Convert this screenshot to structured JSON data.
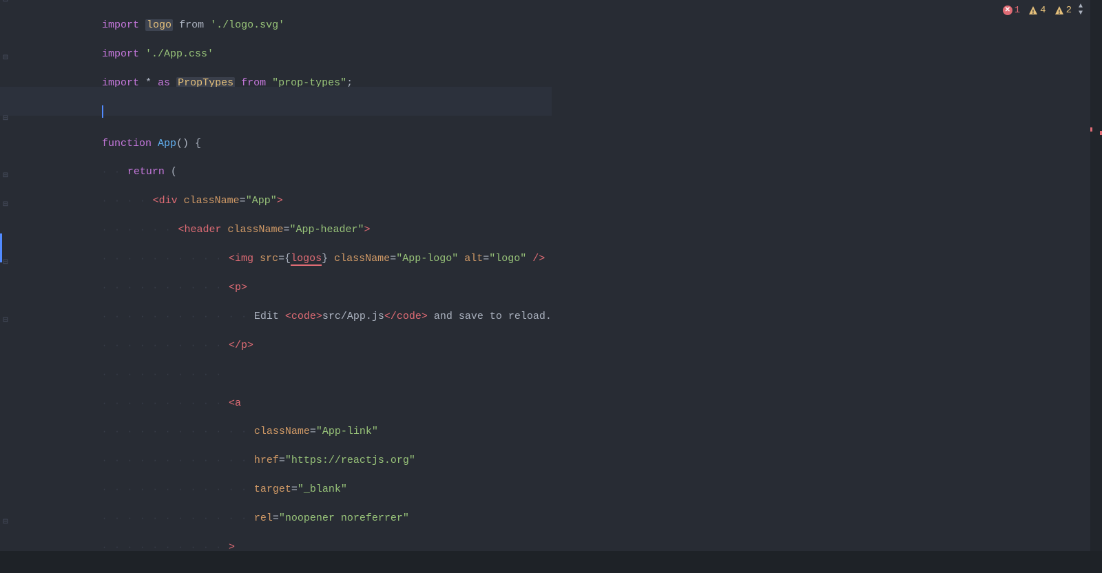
{
  "editor": {
    "background": "#282c34",
    "lines": [
      {
        "id": 1,
        "fold": true,
        "indent": 0,
        "tokens": [
          {
            "type": "kw",
            "text": "import "
          },
          {
            "type": "ident",
            "text": "logo"
          },
          {
            "type": "plain",
            "text": " "
          },
          {
            "type": "plain",
            "text": "from"
          },
          {
            "type": "plain",
            "text": " "
          },
          {
            "type": "str",
            "text": "'./logo.svg'"
          }
        ]
      },
      {
        "id": 2,
        "fold": false,
        "indent": 0,
        "tokens": [
          {
            "type": "kw",
            "text": "import "
          },
          {
            "type": "str",
            "text": "'./App.css'"
          }
        ]
      },
      {
        "id": 3,
        "fold": true,
        "indent": 0,
        "tokens": [
          {
            "type": "kw",
            "text": "import "
          },
          {
            "type": "plain",
            "text": "* "
          },
          {
            "type": "kw",
            "text": "as "
          },
          {
            "type": "ident-highlight",
            "text": "PropTypes"
          },
          {
            "type": "plain",
            "text": " "
          },
          {
            "type": "kw",
            "text": "from"
          },
          {
            "type": "plain",
            "text": " "
          },
          {
            "type": "str-squiggle",
            "text": "\"prop-types\""
          },
          {
            "type": "plain",
            "text": ";"
          }
        ]
      },
      {
        "id": 4,
        "fold": false,
        "indent": 0,
        "active": true,
        "tokens": []
      },
      {
        "id": 5,
        "fold": true,
        "indent": 0,
        "tokens": [
          {
            "type": "kw",
            "text": "function "
          },
          {
            "type": "fn",
            "text": "App"
          },
          {
            "type": "plain",
            "text": "() {"
          }
        ]
      },
      {
        "id": 6,
        "fold": false,
        "indent": 1,
        "dots": 2,
        "tokens": [
          {
            "type": "kw",
            "text": "return"
          },
          {
            "type": "plain",
            "text": " ("
          }
        ]
      },
      {
        "id": 7,
        "fold": true,
        "indent": 2,
        "dots": 4,
        "tokens": [
          {
            "type": "tag",
            "text": "<div"
          },
          {
            "type": "plain",
            "text": " "
          },
          {
            "type": "attr",
            "text": "className"
          },
          {
            "type": "plain",
            "text": "="
          },
          {
            "type": "val",
            "text": "\"App\""
          },
          {
            "type": "tag",
            "text": ">"
          }
        ]
      },
      {
        "id": 8,
        "fold": true,
        "indent": 3,
        "dots": 6,
        "tokens": [
          {
            "type": "tag",
            "text": "<header"
          },
          {
            "type": "plain",
            "text": " "
          },
          {
            "type": "attr",
            "text": "className"
          },
          {
            "type": "plain",
            "text": "="
          },
          {
            "type": "val",
            "text": "\"App-header\""
          },
          {
            "type": "tag",
            "text": ">"
          }
        ]
      },
      {
        "id": 9,
        "fold": false,
        "indent": 4,
        "dots": 10,
        "active_bar": true,
        "tokens": [
          {
            "type": "tag",
            "text": "<img"
          },
          {
            "type": "plain",
            "text": " "
          },
          {
            "type": "attr",
            "text": "src"
          },
          {
            "type": "plain",
            "text": "="
          },
          {
            "type": "plain",
            "text": "{"
          },
          {
            "type": "squiggle-red-span",
            "text": "logos"
          },
          {
            "type": "plain",
            "text": "}"
          },
          {
            "type": "plain",
            "text": " "
          },
          {
            "type": "attr",
            "text": "className"
          },
          {
            "type": "plain",
            "text": "="
          },
          {
            "type": "val",
            "text": "\"App-logo\""
          },
          {
            "type": "plain",
            "text": " "
          },
          {
            "type": "attr",
            "text": "alt"
          },
          {
            "type": "plain",
            "text": "="
          },
          {
            "type": "val",
            "text": "\"logo\""
          },
          {
            "type": "plain",
            "text": " "
          },
          {
            "type": "tag",
            "text": "/>"
          }
        ]
      },
      {
        "id": 10,
        "fold": true,
        "indent": 4,
        "dots": 10,
        "tokens": [
          {
            "type": "tag",
            "text": "<p>"
          }
        ]
      },
      {
        "id": 11,
        "fold": false,
        "indent": 5,
        "dots": 12,
        "tokens": [
          {
            "type": "plain",
            "text": "Edit "
          },
          {
            "type": "tag",
            "text": "<code>"
          },
          {
            "type": "plain",
            "text": "src/App.js"
          },
          {
            "type": "tag",
            "text": "</code>"
          },
          {
            "type": "plain",
            "text": " and save to reload."
          }
        ]
      },
      {
        "id": 12,
        "fold": true,
        "indent": 4,
        "dots": 10,
        "tokens": [
          {
            "type": "tag",
            "text": "</p>"
          }
        ]
      },
      {
        "id": 13,
        "fold": false,
        "indent": 4,
        "dots": 10,
        "tokens": []
      },
      {
        "id": 14,
        "fold": false,
        "indent": 4,
        "dots": 10,
        "tokens": [
          {
            "type": "tag",
            "text": "<a"
          }
        ]
      },
      {
        "id": 15,
        "fold": false,
        "indent": 5,
        "dots": 12,
        "tokens": [
          {
            "type": "attr",
            "text": "className"
          },
          {
            "type": "plain",
            "text": "="
          },
          {
            "type": "val",
            "text": "\"App-link\""
          }
        ]
      },
      {
        "id": 16,
        "fold": false,
        "indent": 5,
        "dots": 12,
        "tokens": [
          {
            "type": "attr",
            "text": "href"
          },
          {
            "type": "plain",
            "text": "="
          },
          {
            "type": "val",
            "text": "\"https://reactjs.org\""
          }
        ]
      },
      {
        "id": 17,
        "fold": false,
        "indent": 5,
        "dots": 12,
        "tokens": [
          {
            "type": "attr",
            "text": "target"
          },
          {
            "type": "plain",
            "text": "="
          },
          {
            "type": "val",
            "text": "\"_blank\""
          }
        ]
      },
      {
        "id": 18,
        "fold": false,
        "indent": 5,
        "dots": 12,
        "tokens": [
          {
            "type": "attr",
            "text": "rel"
          },
          {
            "type": "plain",
            "text": "="
          },
          {
            "type": "val",
            "text": "\"noopener noreferrer\""
          }
        ]
      },
      {
        "id": 19,
        "fold": true,
        "indent": 4,
        "dots": 10,
        "tokens": [
          {
            "type": "tag",
            "text": ">"
          }
        ]
      }
    ],
    "indicators": {
      "errors": {
        "count": 1,
        "color": "#e06c75"
      },
      "warnings1": {
        "count": 4,
        "color": "#e5c07b"
      },
      "warnings2": {
        "count": 2,
        "color": "#e5c07b"
      }
    }
  }
}
